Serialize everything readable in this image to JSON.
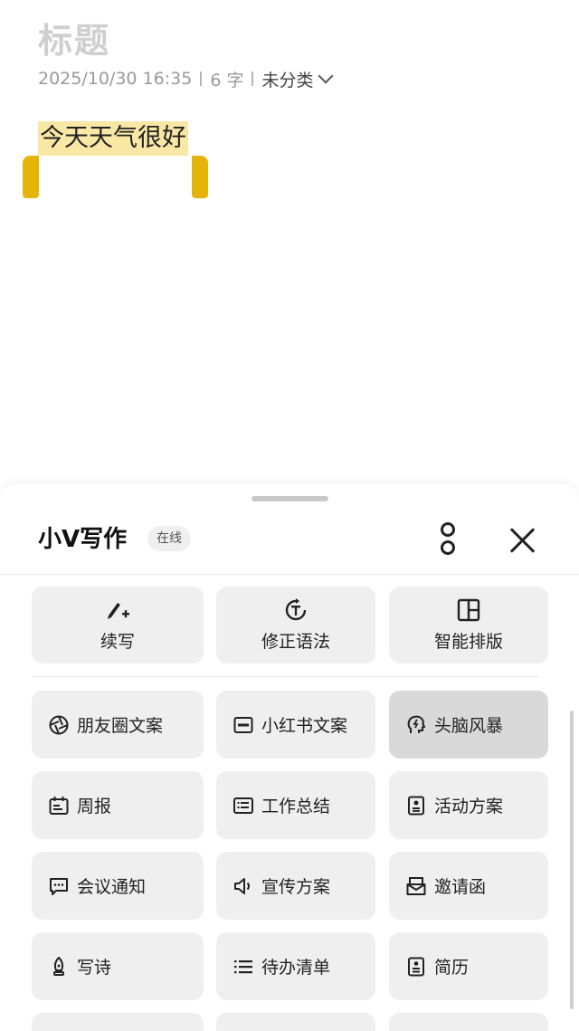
{
  "note": {
    "title_placeholder": "标题",
    "date": "2025/10/30 16:35",
    "word_count": "6 字",
    "category": "未分类",
    "content": "今天天气很好"
  },
  "sheet": {
    "title": "小V写作",
    "badge": "在线",
    "actions": [
      {
        "label": "续写",
        "icon": "pen-plus-icon"
      },
      {
        "label": "修正语法",
        "icon": "grammar-icon"
      },
      {
        "label": "智能排版",
        "icon": "layout-icon"
      }
    ],
    "templates": [
      {
        "label": "朋友圈文案",
        "icon": "aperture-icon"
      },
      {
        "label": "小红书文案",
        "icon": "redbook-icon"
      },
      {
        "label": "头脑风暴",
        "icon": "brain-icon",
        "selected": true
      },
      {
        "label": "周报",
        "icon": "calendar-icon"
      },
      {
        "label": "工作总结",
        "icon": "list-card-icon"
      },
      {
        "label": "活动方案",
        "icon": "document-person-icon"
      },
      {
        "label": "会议通知",
        "icon": "message-icon"
      },
      {
        "label": "宣传方案",
        "icon": "speaker-icon"
      },
      {
        "label": "邀请函",
        "icon": "mail-icon"
      },
      {
        "label": "写诗",
        "icon": "quill-icon"
      },
      {
        "label": "待办清单",
        "icon": "checklist-icon"
      },
      {
        "label": "简历",
        "icon": "resume-icon"
      }
    ]
  },
  "colors": {
    "highlight": "#f9e7a6",
    "selection_handle": "#e5b408",
    "tile_bg": "#efefef",
    "tile_selected_bg": "#d9d9d9"
  }
}
